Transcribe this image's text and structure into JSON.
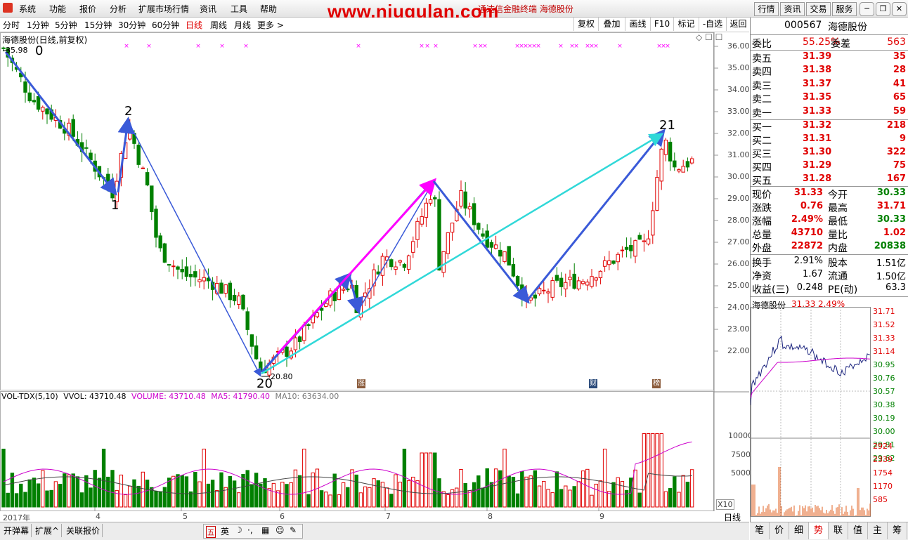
{
  "menu": {
    "items": [
      "系统",
      "功能",
      "报价",
      "分析",
      "扩展市场行情",
      "资讯",
      "工具",
      "帮助"
    ],
    "brand": "www.niugulan.com",
    "title_overlap": "通达信金融终端 海德股份",
    "right_buttons": [
      "行情",
      "资讯",
      "交易",
      "服务"
    ]
  },
  "toolbar": {
    "periods": [
      "分时",
      "1分钟",
      "5分钟",
      "15分钟",
      "30分钟",
      "60分钟",
      "日线",
      "周线",
      "月线",
      "更多 >"
    ],
    "active_period": "日线",
    "tools": [
      "复权",
      "叠加",
      "画线",
      "F10",
      "标记",
      "-自选",
      "返回"
    ]
  },
  "chart": {
    "stock_label": "海德股份(日线,前复权)",
    "high_mark": "35.98",
    "low_mark": "20.80",
    "wave_labels": [
      "0",
      "2",
      "1",
      "20",
      "21"
    ],
    "event_badges": [
      "涨",
      "财",
      "榜"
    ],
    "price_ticks": [
      "36.00",
      "35.00",
      "34.00",
      "33.00",
      "32.00",
      "31.00",
      "30.00",
      "29.00",
      "28.00",
      "27.00",
      "26.00",
      "25.00",
      "24.00",
      "23.00",
      "22.00"
    ],
    "volume_header": {
      "name": "VOL-TDX(5,10)",
      "vvol": "VVOL: 43710.48",
      "volume": "VOLUME: 43710.48",
      "ma5": "MA5: 41790.40",
      "ma10": "MA10: 63634.00"
    },
    "volume_ticks": [
      "10000",
      "7500",
      "5000"
    ],
    "volume_unit": "X10",
    "date_ticks": [
      "2017年",
      "4",
      "5",
      "6",
      "7",
      "8",
      "9"
    ],
    "period_label": "日线"
  },
  "quote": {
    "code": "000567",
    "name": "海德股份",
    "weibi_label": "委比",
    "weibi": "55.25%",
    "weicha_label": "委差",
    "weicha": "563",
    "asks": [
      {
        "label": "卖五",
        "price": "31.39",
        "vol": "35"
      },
      {
        "label": "卖四",
        "price": "31.38",
        "vol": "28"
      },
      {
        "label": "卖三",
        "price": "31.37",
        "vol": "41"
      },
      {
        "label": "卖二",
        "price": "31.35",
        "vol": "65"
      },
      {
        "label": "卖一",
        "price": "31.33",
        "vol": "59"
      }
    ],
    "bids": [
      {
        "label": "买一",
        "price": "31.32",
        "vol": "218"
      },
      {
        "label": "买二",
        "price": "31.31",
        "vol": "9"
      },
      {
        "label": "买三",
        "price": "31.30",
        "vol": "322"
      },
      {
        "label": "买四",
        "price": "31.29",
        "vol": "75"
      },
      {
        "label": "买五",
        "price": "31.28",
        "vol": "167"
      }
    ],
    "stats": [
      {
        "l1": "现价",
        "v1": "31.33",
        "c1": "red",
        "l2": "今开",
        "v2": "30.33",
        "c2": "grn"
      },
      {
        "l1": "涨跌",
        "v1": "0.76",
        "c1": "red",
        "l2": "最高",
        "v2": "31.71",
        "c2": "red"
      },
      {
        "l1": "涨幅",
        "v1": "2.49%",
        "c1": "red",
        "l2": "最低",
        "v2": "30.33",
        "c2": "grn"
      },
      {
        "l1": "总量",
        "v1": "43710",
        "c1": "red",
        "l2": "量比",
        "v2": "1.02",
        "c2": "red"
      },
      {
        "l1": "外盘",
        "v1": "22872",
        "c1": "red",
        "l2": "内盘",
        "v2": "20838",
        "c2": "grn"
      }
    ],
    "fund": [
      {
        "l1": "换手",
        "v1": "2.91%",
        "l2": "股本",
        "v2": "1.51亿"
      },
      {
        "l1": "净资",
        "v1": "1.67",
        "l2": "流通",
        "v2": "1.50亿"
      },
      {
        "l1": "收益(三)",
        "v1": "0.248",
        "l2": "PE(动)",
        "v2": "63.3"
      }
    ],
    "intraday": {
      "name": "海德股份",
      "price": "31.33",
      "pct": "2.49%",
      "price_ticks": [
        "31.71",
        "31.52",
        "31.33",
        "31.14",
        "30.95",
        "30.76",
        "30.57",
        "30.38",
        "30.19",
        "30.00",
        "29.81",
        "29.62"
      ],
      "vol_ticks": [
        "2924",
        "2339",
        "1754",
        "1170",
        "585"
      ]
    },
    "tabs": [
      "笔",
      "价",
      "细",
      "势",
      "联",
      "值",
      "主",
      "筹"
    ],
    "active_tab": "势"
  },
  "bottom": {
    "tabs": [
      "开弹幕",
      "扩展^",
      "关联报价"
    ],
    "ime": [
      "五",
      "英",
      "☽",
      "·,",
      "▦",
      "☺",
      "✎"
    ]
  },
  "colors": {
    "up": "#e00000",
    "down": "#008000",
    "wave": "#3a5ad8",
    "magenta": "#ff00ff",
    "cyan": "#30d8d8",
    "ma5": "#cc00cc",
    "ma10": "#444444"
  }
}
